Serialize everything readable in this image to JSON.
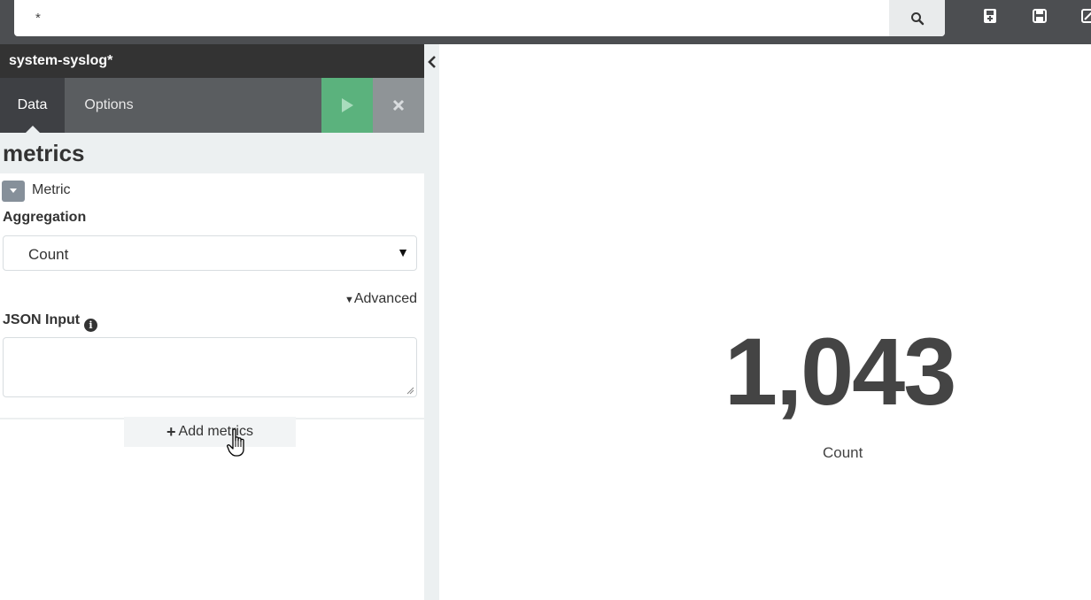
{
  "search": {
    "value": "*"
  },
  "sidebar": {
    "index_title": "system-syslog*",
    "tabs": [
      {
        "label": "Data"
      },
      {
        "label": "Options"
      }
    ],
    "section_title": "metrics",
    "metric": {
      "label": "Metric",
      "aggregation_label": "Aggregation",
      "aggregation_value": "Count",
      "advanced_label": "Advanced",
      "json_input_label": "JSON Input",
      "json_input_value": ""
    },
    "add_metrics_label": "Add metrics"
  },
  "visualization": {
    "value": "1,043",
    "label": "Count"
  },
  "colors": {
    "topbar": "#4c4e51",
    "apply_green": "#5bb27d",
    "tab_active": "#3e4044",
    "tab_row": "#5a5d60",
    "value_text": "#444444"
  }
}
